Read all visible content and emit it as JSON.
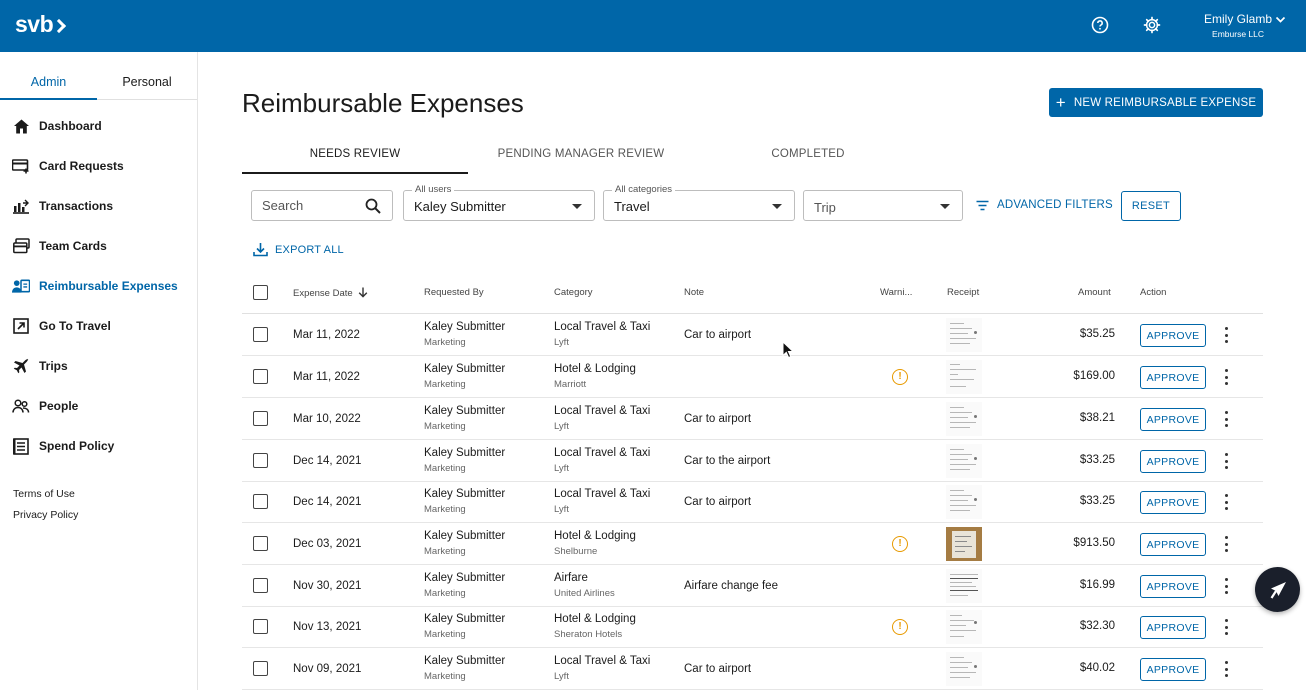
{
  "app": {
    "brand": "svb",
    "user_name": "Emily Glamb",
    "user_org": "Emburse LLC",
    "accent_color": "#0066a8",
    "warning_color": "#e89a00",
    "icons": [
      "help-icon",
      "gear-icon",
      "chevron-down-icon"
    ]
  },
  "sidebar": {
    "tabs": {
      "admin": "Admin",
      "personal": "Personal"
    },
    "items": [
      {
        "label": "Dashboard",
        "icon": "home-icon"
      },
      {
        "label": "Card Requests",
        "icon": "card-request-icon"
      },
      {
        "label": "Transactions",
        "icon": "transactions-icon"
      },
      {
        "label": "Team Cards",
        "icon": "team-cards-icon"
      },
      {
        "label": "Reimbursable Expenses",
        "icon": "reimbursable-icon"
      },
      {
        "label": "Go To Travel",
        "icon": "external-link-icon"
      },
      {
        "label": "Trips",
        "icon": "plane-icon"
      },
      {
        "label": "People",
        "icon": "people-icon"
      },
      {
        "label": "Spend Policy",
        "icon": "policy-icon"
      }
    ],
    "active_item": "Reimbursable Expenses",
    "terms": "Terms of Use",
    "privacy": "Privacy Policy"
  },
  "page": {
    "title": "Reimbursable Expenses",
    "new_button": "NEW REIMBURSABLE EXPENSE"
  },
  "tabs": [
    {
      "label": "NEEDS REVIEW",
      "active": true
    },
    {
      "label": "PENDING MANAGER REVIEW",
      "active": false
    },
    {
      "label": "COMPLETED",
      "active": false
    }
  ],
  "filters": {
    "search_placeholder": "Search",
    "users_label": "All users",
    "users_value": "Kaley Submitter",
    "categories_label": "All categories",
    "categories_value": "Travel",
    "trip_placeholder": "Trip",
    "advanced": "ADVANCED FILTERS",
    "reset": "RESET",
    "export": "EXPORT ALL"
  },
  "table": {
    "headers": {
      "date": "Expense Date",
      "requested_by": "Requested By",
      "category": "Category",
      "note": "Note",
      "warnings": "Warni...",
      "receipt": "Receipt",
      "amount": "Amount",
      "action": "Action"
    },
    "sort": "expense-date-descending",
    "approve_label": "APPROVE",
    "warning_glyph": "!",
    "rows": [
      {
        "date": "Mar 11, 2022",
        "name": "Kaley Submitter",
        "dept": "Marketing",
        "category": "Local Travel & Taxi",
        "vendor": "Lyft",
        "note": "Car to airport",
        "warning": false,
        "receipt": "document",
        "amount": "$35.25"
      },
      {
        "date": "Mar 11, 2022",
        "name": "Kaley Submitter",
        "dept": "Marketing",
        "category": "Hotel & Lodging",
        "vendor": "Marriott",
        "note": "",
        "warning": true,
        "receipt": "document",
        "amount": "$169.00"
      },
      {
        "date": "Mar 10, 2022",
        "name": "Kaley Submitter",
        "dept": "Marketing",
        "category": "Local Travel & Taxi",
        "vendor": "Lyft",
        "note": "Car to airport",
        "warning": false,
        "receipt": "document",
        "amount": "$38.21"
      },
      {
        "date": "Dec 14, 2021",
        "name": "Kaley Submitter",
        "dept": "Marketing",
        "category": "Local Travel & Taxi",
        "vendor": "Lyft",
        "note": "Car to the airport",
        "warning": false,
        "receipt": "document",
        "amount": "$33.25"
      },
      {
        "date": "Dec 14, 2021",
        "name": "Kaley Submitter",
        "dept": "Marketing",
        "category": "Local Travel & Taxi",
        "vendor": "Lyft",
        "note": "Car to airport",
        "warning": false,
        "receipt": "document",
        "amount": "$33.25"
      },
      {
        "date": "Dec 03, 2021",
        "name": "Kaley Submitter",
        "dept": "Marketing",
        "category": "Hotel & Lodging",
        "vendor": "Shelburne",
        "note": "",
        "warning": true,
        "receipt": "photo",
        "amount": "$913.50"
      },
      {
        "date": "Nov 30, 2021",
        "name": "Kaley Submitter",
        "dept": "Marketing",
        "category": "Airfare",
        "vendor": "United Airlines",
        "note": "Airfare change fee",
        "warning": false,
        "receipt": "document",
        "amount": "$16.99"
      },
      {
        "date": "Nov 13, 2021",
        "name": "Kaley Submitter",
        "dept": "Marketing",
        "category": "Hotel & Lodging",
        "vendor": "Sheraton Hotels",
        "note": "",
        "warning": true,
        "receipt": "document",
        "amount": "$32.30"
      },
      {
        "date": "Nov 09, 2021",
        "name": "Kaley Submitter",
        "dept": "Marketing",
        "category": "Local Travel & Taxi",
        "vendor": "Lyft",
        "note": "Car to airport",
        "warning": false,
        "receipt": "document",
        "amount": "$40.02"
      }
    ]
  },
  "chat": {
    "icon": "chat-icon"
  }
}
